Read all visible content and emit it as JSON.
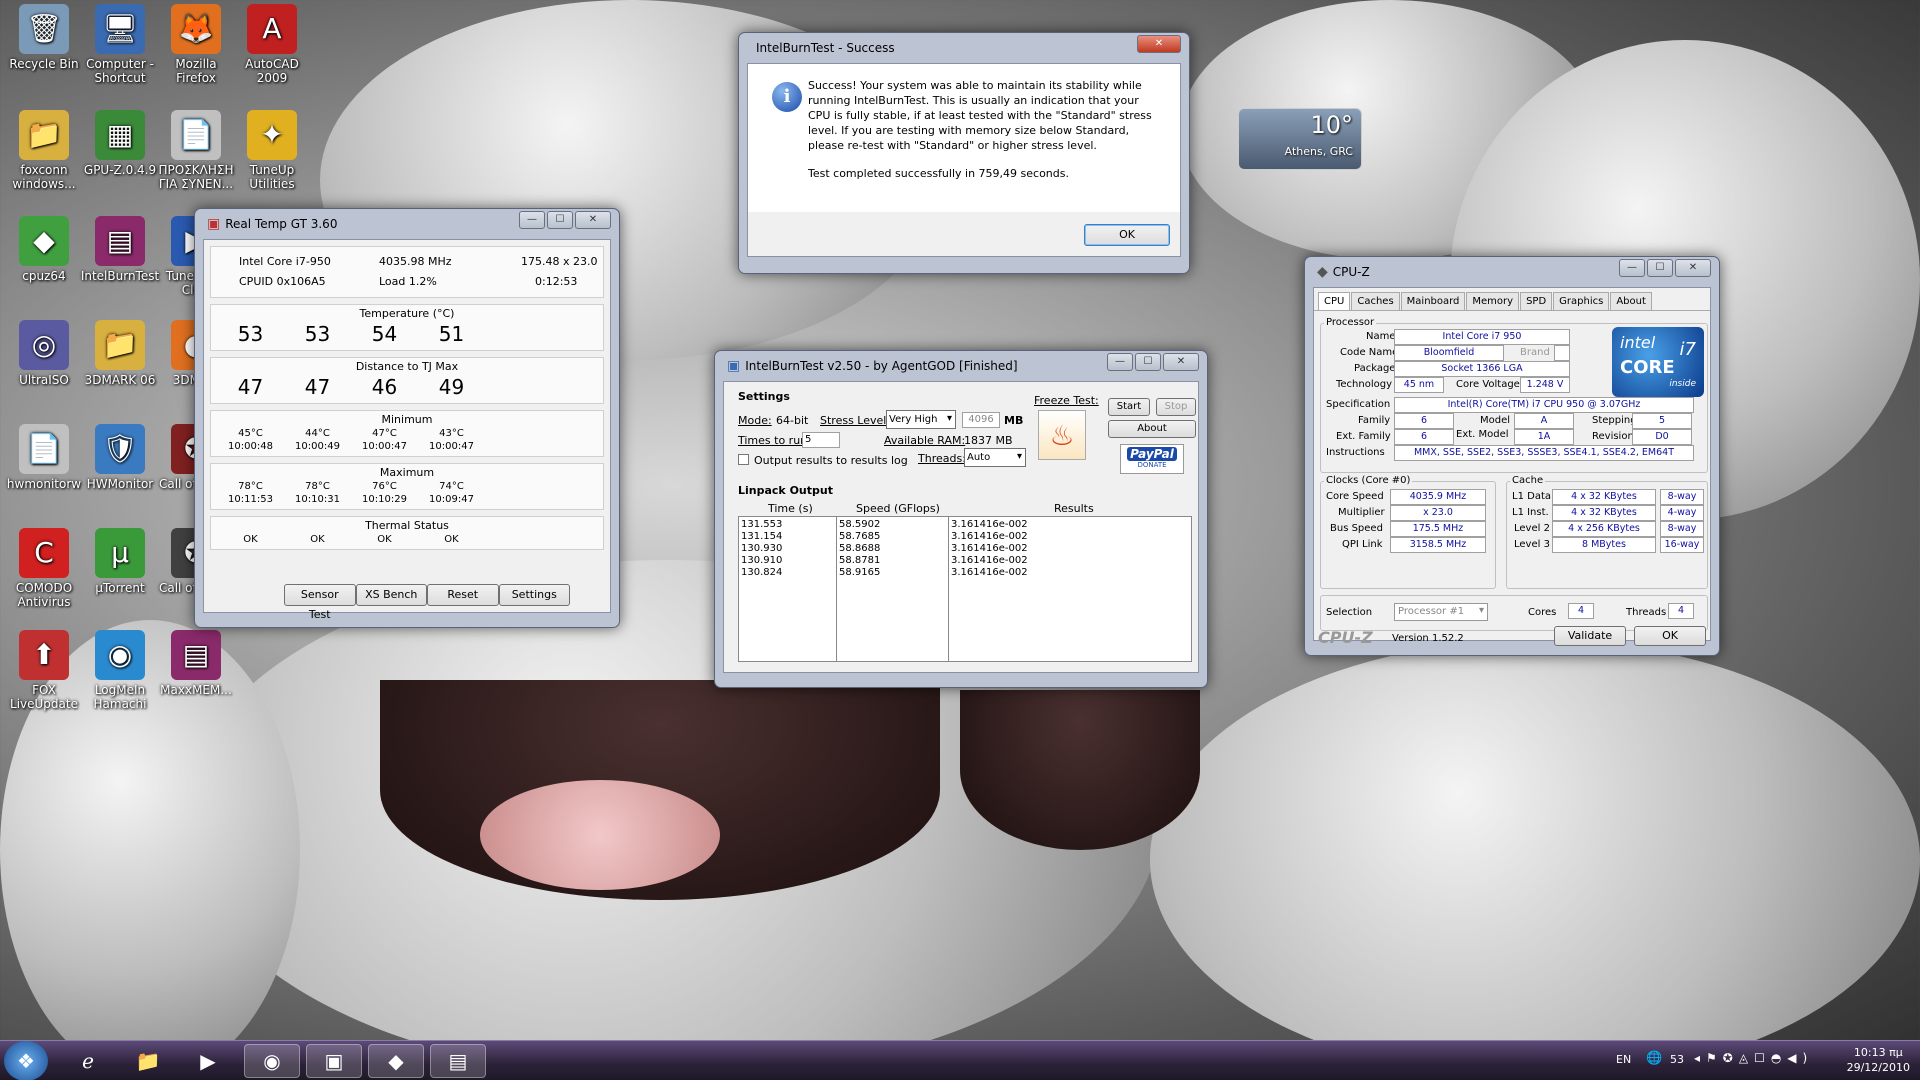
{
  "desktop": {
    "icons": [
      {
        "label": "Recycle Bin",
        "glyph": "🗑",
        "color": "#7a9ab8",
        "icon": "recycle-bin-icon"
      },
      {
        "label": "Computer - Shortcut",
        "glyph": "🖥",
        "color": "#3a6ab0",
        "icon": "computer-icon"
      },
      {
        "label": "Mozilla Firefox",
        "glyph": "🦊",
        "color": "#e07020",
        "icon": "firefox-icon"
      },
      {
        "label": "AutoCAD 2009",
        "glyph": "A",
        "color": "#c02020",
        "icon": "autocad-icon"
      },
      {
        "label": "foxconn windows...",
        "glyph": "📁",
        "color": "#d8b040",
        "icon": "folder-icon"
      },
      {
        "label": "GPU-Z.0.4.9",
        "glyph": "▦",
        "color": "#3a8a3a",
        "icon": "gpuz-icon"
      },
      {
        "label": "ΠΡΟΣΚΛΗΣΗ ΓΙΑ ΣΥΝΕΝ...",
        "glyph": "📄",
        "color": "#c0c0c0",
        "icon": "document-icon"
      },
      {
        "label": "TuneUp Utilities",
        "glyph": "✦",
        "color": "#e0b020",
        "icon": "tuneup-icon"
      },
      {
        "label": "cpuz64",
        "glyph": "◆",
        "color": "#40a040",
        "icon": "cpuz-icon"
      },
      {
        "label": "IntelBurnTest",
        "glyph": "▤",
        "color": "#8a2a6a",
        "icon": "winrar-icon"
      },
      {
        "label": "TuneUp 1-Click",
        "glyph": "▶",
        "color": "#2a5ab0",
        "icon": "tuneup-oneclick-icon"
      },
      {
        "label": "UltraISO",
        "glyph": "◎",
        "color": "#5a5aa0",
        "icon": "ultraiso-icon"
      },
      {
        "label": "3DMARK 06",
        "glyph": "📁",
        "color": "#d8b040",
        "icon": "folder-icon"
      },
      {
        "label": "3DMark",
        "glyph": "◐",
        "color": "#e07020",
        "icon": "3dmark-icon"
      },
      {
        "label": "hwmonitorw",
        "glyph": "📄",
        "color": "#c0c0c0",
        "icon": "document-icon"
      },
      {
        "label": "HWMonitor",
        "glyph": "🛡",
        "color": "#3a7ac0",
        "icon": "hwmonitor-icon"
      },
      {
        "label": "Call of Black",
        "glyph": "✪",
        "color": "#802020",
        "icon": "callofduty-icon"
      },
      {
        "label": "COMODO Antivirus",
        "glyph": "C",
        "color": "#d02020",
        "icon": "comodo-icon"
      },
      {
        "label": "µTorrent",
        "glyph": "µ",
        "color": "#3a9a3a",
        "icon": "utorrent-icon"
      },
      {
        "label": "Call of Black",
        "glyph": "✪",
        "color": "#404040",
        "icon": "callofduty-icon"
      },
      {
        "label": "FOX LiveUpdate",
        "glyph": "⬆",
        "color": "#c03030",
        "icon": "liveupdate-icon"
      },
      {
        "label": "LogMeIn Hamachi",
        "glyph": "◉",
        "color": "#2a8ad0",
        "icon": "hamachi-icon"
      },
      {
        "label": "MaxxMEM...",
        "glyph": "▤",
        "color": "#8a2a6a",
        "icon": "winrar-icon"
      }
    ]
  },
  "weather": {
    "temp": "10°",
    "city": "Athens, GRC"
  },
  "success": {
    "title": "IntelBurnTest - Success",
    "msg1": "Success! Your system was able to maintain its stability while running IntelBurnTest. This is usually an indication that your CPU is fully stable, if at least tested with the \"Standard\" stress level. If you are testing with memory size below Standard, please re-test with \"Standard\" or higher stress level.",
    "msg2": "Test completed successfully in 759,49 seconds.",
    "ok": "OK"
  },
  "realtemp": {
    "title": "Real Temp GT 3.60",
    "cpu": "Intel Core i7-950",
    "mhz": "4035.98 MHz",
    "ratio": "175.48 x 23.0",
    "cpuid": "CPUID  0x106A5",
    "load": "Load   1.2%",
    "time": "0:12:53",
    "temp_label": "Temperature (°C)",
    "temps": [
      "53",
      "53",
      "54",
      "51"
    ],
    "dist_label": "Distance to TJ Max",
    "dists": [
      "47",
      "47",
      "46",
      "49"
    ],
    "min_label": "Minimum",
    "mins": [
      "45°C",
      "44°C",
      "47°C",
      "43°C"
    ],
    "min_times": [
      "10:00:48",
      "10:00:49",
      "10:00:47",
      "10:00:47"
    ],
    "max_label": "Maximum",
    "maxs": [
      "78°C",
      "78°C",
      "76°C",
      "74°C"
    ],
    "max_times": [
      "10:11:53",
      "10:10:31",
      "10:10:29",
      "10:09:47"
    ],
    "status_label": "Thermal Status",
    "status": [
      "OK",
      "OK",
      "OK",
      "OK"
    ],
    "buttons": [
      "Sensor Test",
      "XS Bench",
      "Reset",
      "Settings"
    ]
  },
  "ibt": {
    "title": "IntelBurnTest v2.50 - by AgentGOD [Finished]",
    "settings": "Settings",
    "mode_label": "Mode:",
    "mode": "64-bit",
    "stress_label": "Stress Level:",
    "stress": "Very High",
    "mem": "4096",
    "mb": "MB",
    "freeze": "Freeze Test:",
    "start": "Start",
    "stop": "Stop",
    "about": "About",
    "times_label": "Times to run:",
    "times": "5",
    "ram_label": "Available RAM:",
    "ram": "1837 MB",
    "log": "Output results to results log",
    "threads_label": "Threads:",
    "threads": "Auto",
    "paypal": "PayPal",
    "donate": "DONATE",
    "linpack": "Linpack Output",
    "cols": [
      "Time (s)",
      "Speed (GFlops)",
      "Results"
    ],
    "times_col": [
      "131.553",
      "131.154",
      "130.930",
      "130.910",
      "130.824"
    ],
    "speeds": [
      "58.5902",
      "58.7685",
      "58.8688",
      "58.8781",
      "58.9165"
    ],
    "results": [
      "3.161416e-002",
      "3.161416e-002",
      "3.161416e-002",
      "3.161416e-002",
      "3.161416e-002"
    ]
  },
  "cpuz": {
    "title": "CPU-Z",
    "tabs": [
      "CPU",
      "Caches",
      "Mainboard",
      "Memory",
      "SPD",
      "Graphics",
      "About"
    ],
    "processor": "Processor",
    "name_l": "Name",
    "name": "Intel Core i7 950",
    "code_l": "Code Name",
    "code": "Bloomfield",
    "brand": "Brand ID",
    "pkg_l": "Package",
    "pkg": "Socket 1366 LGA",
    "tech_l": "Technology",
    "tech": "45 nm",
    "volt_l": "Core Voltage",
    "volt": "1.248 V",
    "spec_l": "Specification",
    "spec": "Intel(R) Core(TM) i7 CPU        950  @ 3.07GHz",
    "fam_l": "Family",
    "fam": "6",
    "model_l": "Model",
    "model": "A",
    "step_l": "Stepping",
    "step": "5",
    "efam_l": "Ext. Family",
    "efam": "6",
    "emod_l": "Ext. Model",
    "emod": "1A",
    "rev_l": "Revision",
    "rev": "D0",
    "instr_l": "Instructions",
    "instr": "MMX, SSE, SSE2, SSE3, SSSE3, SSE4.1, SSE4.2, EM64T",
    "clocks": "Clocks (Core #0)",
    "cs_l": "Core Speed",
    "cs": "4035.9 MHz",
    "mul_l": "Multiplier",
    "mul": "x 23.0",
    "bus_l": "Bus Speed",
    "bus": "175.5 MHz",
    "qpi_l": "QPI Link",
    "qpi": "3158.5 MHz",
    "cache": "Cache",
    "l1d_l": "L1 Data",
    "l1d": "4 x 32 KBytes",
    "l1d_w": "8-way",
    "l1i_l": "L1 Inst.",
    "l1i": "4 x 32 KBytes",
    "l1i_w": "4-way",
    "l2_l": "Level 2",
    "l2": "4 x 256 KBytes",
    "l2_w": "8-way",
    "l3_l": "Level 3",
    "l3": "8 MBytes",
    "l3_w": "16-way",
    "sel_l": "Selection",
    "sel": "Processor #1",
    "cores_l": "Cores",
    "cores": "4",
    "thr_l": "Threads",
    "thr": "4",
    "brand_name": "CPU-Z",
    "version": "Version 1.52.2",
    "validate": "Validate",
    "ok": "OK",
    "intel": "intel",
    "core": "CORE",
    "i7": "i7",
    "inside": "inside"
  },
  "taskbar": {
    "lang": "EN",
    "temp": "53",
    "time": "10:13 πμ",
    "date": "29/12/2010"
  }
}
